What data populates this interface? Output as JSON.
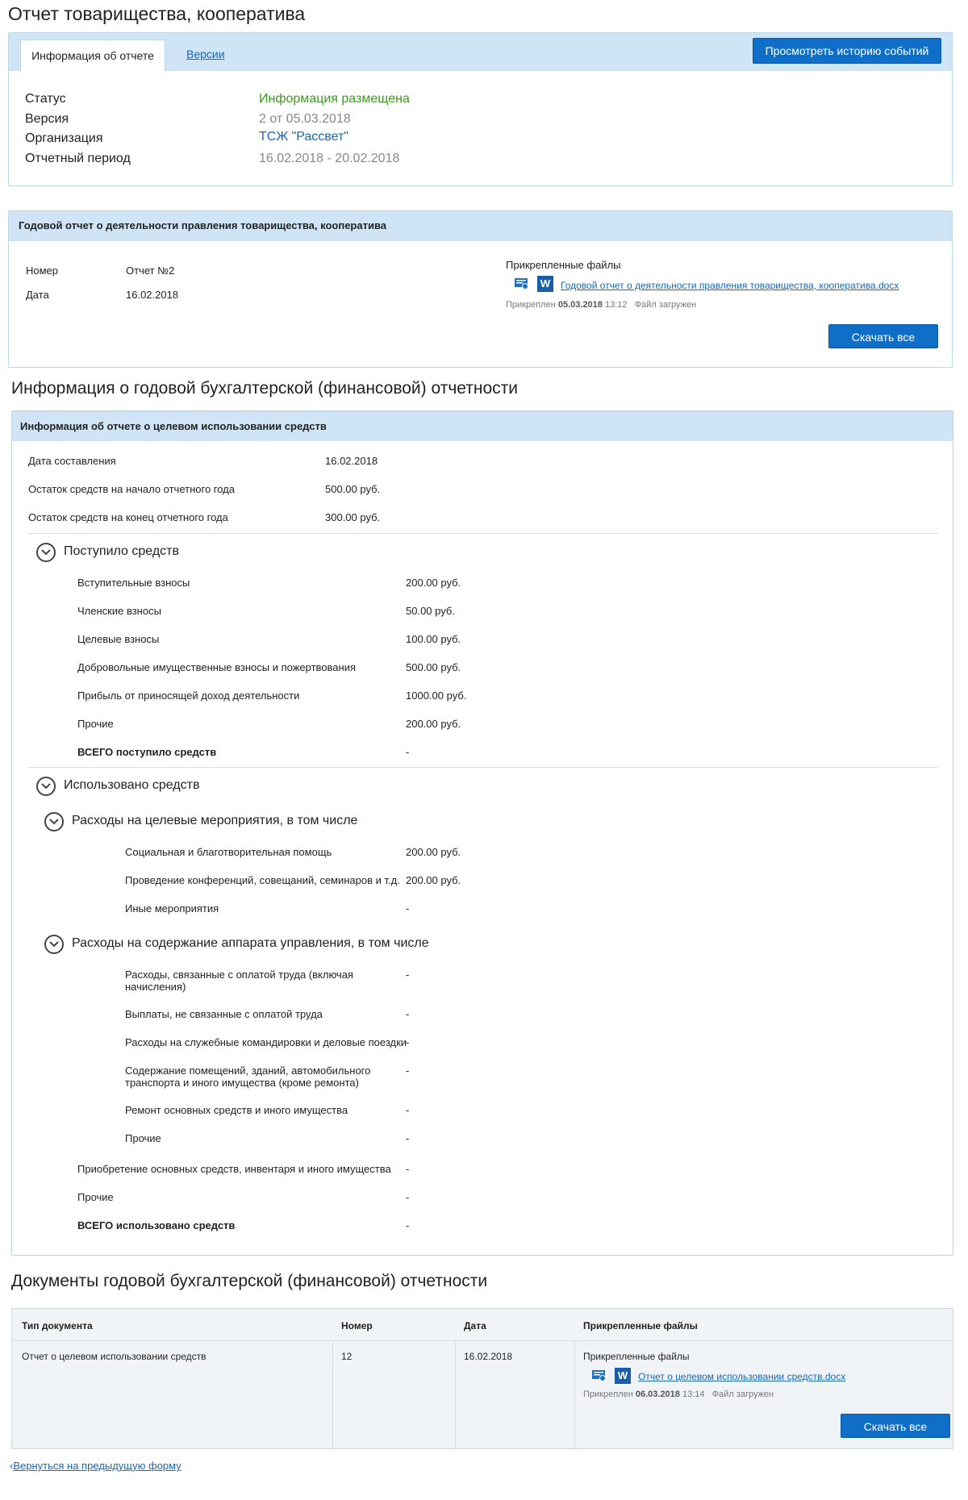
{
  "page_title": "Отчет товарищества, кооператива",
  "tabs": [
    {
      "label": "Информация об отчете",
      "active": true
    },
    {
      "label": "Версии",
      "active": false
    }
  ],
  "history_button": "Просмотреть историю событий",
  "report_info": {
    "status_label": "Статус",
    "status_value": "Информация размещена",
    "version_label": "Версия",
    "version_value": "2 от 05.03.2018",
    "org_label": "Организация",
    "org_value": "ТСЖ \"Рассвет\"",
    "period_label": "Отчетный период",
    "period_value": "16.02.2018 - 20.02.2018"
  },
  "annual_report": {
    "header": "Годовой отчет о деятельности правления товарищества, кооператива",
    "number_label": "Номер",
    "number_value": "Отчет №2",
    "date_label": "Дата",
    "date_value": "16.02.2018",
    "files_label": "Прикрепленные файлы",
    "file_name": "Годовой отчет о деятельности правления товарищества, кооператива.docx",
    "attached_prefix": "Прикреплен",
    "attached_date": "05.03.2018",
    "attached_time": "13:12",
    "file_status": "Файл загружен",
    "download_all": "Скачать все"
  },
  "fin_section_title": "Информация о годовой бухгалтерской (финансовой) отчетности",
  "fin_info": {
    "header": "Информация об отчете о целевом использовании средств",
    "top_rows": [
      {
        "label": "Дата составления",
        "value": "16.02.2018"
      },
      {
        "label": "Остаток средств на начало отчетного года",
        "value": "500.00 руб."
      },
      {
        "label": "Остаток средств на конец отчетного года",
        "value": "300.00 руб."
      }
    ],
    "income_title": "Поступило средств",
    "income_rows": [
      {
        "label": "Вступительные взносы",
        "value": "200.00 руб."
      },
      {
        "label": "Членские взносы",
        "value": "50.00 руб."
      },
      {
        "label": "Целевые взносы",
        "value": "100.00 руб."
      },
      {
        "label": "Добровольные имущественные взносы и пожертвования",
        "value": "500.00 руб."
      },
      {
        "label": "Прибыль от приносящей доход деятельности",
        "value": "1000.00 руб."
      },
      {
        "label": "Прочие",
        "value": "200.00 руб."
      }
    ],
    "income_total": {
      "label": "ВСЕГО поступило средств",
      "value": "-"
    },
    "used_title": "Использовано средств",
    "targeted_title": "Расходы на целевые мероприятия, в том числе",
    "targeted_rows": [
      {
        "label": "Социальная и благотворительная помощь",
        "value": "200.00 руб."
      },
      {
        "label": "Проведение конференций, совещаний, семинаров и т.д.",
        "value": "200.00 руб."
      },
      {
        "label": "Иные мероприятия",
        "value": "-"
      }
    ],
    "admin_title": "Расходы на содержание аппарата управления, в том числе",
    "admin_rows": [
      {
        "label": "Расходы, связанные с оплатой труда (включая начисления)",
        "value": "-"
      },
      {
        "label": "Выплаты, не связанные с оплатой труда",
        "value": "-"
      },
      {
        "label": "Расходы на служебные командировки и деловые поездки",
        "value": "-"
      },
      {
        "label": "Содержание помещений, зданий, автомобильного транспорта и иного имущества (кроме ремонта)",
        "value": "-"
      },
      {
        "label": "Ремонт основных средств и иного имущества",
        "value": "-"
      },
      {
        "label": "Прочие",
        "value": "-"
      }
    ],
    "other_rows": [
      {
        "label": "Приобретение основных средств, инвентаря и иного имущества",
        "value": "-"
      },
      {
        "label": "Прочие",
        "value": "-"
      }
    ],
    "used_total": {
      "label": "ВСЕГО использовано средств",
      "value": "-"
    }
  },
  "docs_section_title": "Документы годовой бухгалтерской (финансовой) отчетности",
  "docs_table": {
    "headers": [
      "Тип документа",
      "Номер",
      "Дата",
      "Прикрепленные файлы"
    ],
    "row": {
      "type": "Отчет о целевом использовании средств",
      "number": "12",
      "date": "16.02.2018",
      "files_label": "Прикрепленные файлы",
      "file_name": "Отчет о целевом использовании средств.docx",
      "attached_prefix": "Прикреплен",
      "attached_date": "06.03.2018",
      "attached_time": "13:14",
      "file_status": "Файл загружен",
      "download_all": "Скачать все"
    }
  },
  "back_link": "Вернуться на предыдущую форму",
  "colors": {
    "accent": "#0f6ec8",
    "status_green": "#3b9a1f",
    "org_blue": "#1667b8",
    "muted": "#888888",
    "panel_head": "#cfe4f5"
  }
}
